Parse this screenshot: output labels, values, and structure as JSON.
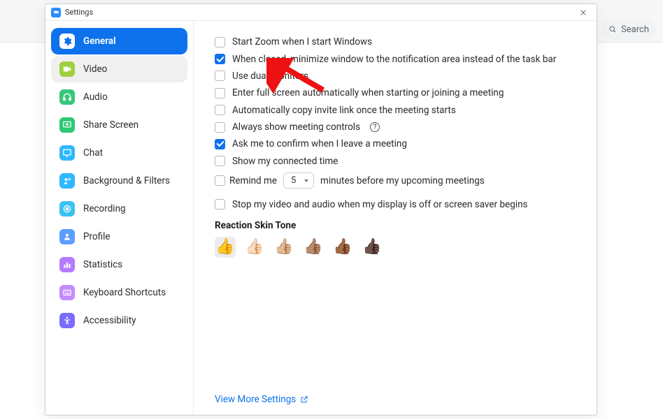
{
  "search": {
    "placeholder": "Search"
  },
  "dialog": {
    "title": "Settings"
  },
  "sidebar": {
    "items": [
      {
        "label": "General",
        "icon": "gear-icon",
        "bg": "#ffffff",
        "fg": "#0e72ed",
        "active": true
      },
      {
        "label": "Video",
        "icon": "video-icon",
        "bg": "#9fcf3e",
        "fg": "#ffffff",
        "hover": true
      },
      {
        "label": "Audio",
        "icon": "headphones-icon",
        "bg": "#35c77a",
        "fg": "#ffffff"
      },
      {
        "label": "Share Screen",
        "icon": "share-screen-icon",
        "bg": "#2ec973",
        "fg": "#ffffff"
      },
      {
        "label": "Chat",
        "icon": "chat-icon",
        "bg": "#2fb8ff",
        "fg": "#ffffff"
      },
      {
        "label": "Background & Filters",
        "icon": "background-icon",
        "bg": "#2fb8ff",
        "fg": "#ffffff"
      },
      {
        "label": "Recording",
        "icon": "recording-icon",
        "bg": "#3ac2f0",
        "fg": "#ffffff"
      },
      {
        "label": "Profile",
        "icon": "profile-icon",
        "bg": "#5b9eff",
        "fg": "#ffffff"
      },
      {
        "label": "Statistics",
        "icon": "statistics-icon",
        "bg": "#b37bff",
        "fg": "#ffffff"
      },
      {
        "label": "Keyboard Shortcuts",
        "icon": "keyboard-icon",
        "bg": "#c48cff",
        "fg": "#ffffff"
      },
      {
        "label": "Accessibility",
        "icon": "accessibility-icon",
        "bg": "#7a6cff",
        "fg": "#ffffff"
      }
    ]
  },
  "general": {
    "options": [
      {
        "label": "Start Zoom when I start Windows",
        "checked": false
      },
      {
        "label": "When closed, minimize window to the notification area instead of the task bar",
        "checked": true
      },
      {
        "label": "Use dual monitors",
        "checked": false
      },
      {
        "label": "Enter full screen automatically when starting or joining a meeting",
        "checked": false
      },
      {
        "label": "Automatically copy invite link once the meeting starts",
        "checked": false
      },
      {
        "label": "Always show meeting controls",
        "checked": false,
        "help": true
      },
      {
        "label": "Ask me to confirm when I leave a meeting",
        "checked": true
      },
      {
        "label": "Show my connected time",
        "checked": false
      }
    ],
    "remind": {
      "prefix": "Remind me",
      "value": "5",
      "suffix": "minutes before my upcoming meetings",
      "checked": false
    },
    "stop_video": {
      "label": "Stop my video and audio when my display is off or screen saver begins",
      "checked": false
    },
    "reaction_title": "Reaction Skin Tone",
    "thumbs": [
      "👍",
      "👍🏻",
      "👍🏼",
      "👍🏽",
      "👍🏾",
      "👍🏿"
    ],
    "view_more": "View More Settings"
  }
}
